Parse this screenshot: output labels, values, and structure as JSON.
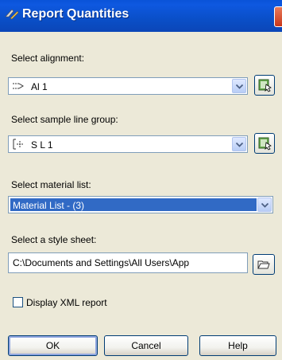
{
  "window": {
    "title": "Report Quantities"
  },
  "alignment": {
    "label": "Select alignment:",
    "value": "Al 1"
  },
  "sample_line_group": {
    "label": "Select sample line group:",
    "value": "S L 1"
  },
  "material_list": {
    "label": "Select material list:",
    "value": "Material List - (3)"
  },
  "style_sheet": {
    "label": "Select a style sheet:",
    "value": "C:\\Documents and Settings\\All Users\\App"
  },
  "xml_report": {
    "label": "Display XML report",
    "checked": false
  },
  "buttons": {
    "ok": "OK",
    "cancel": "Cancel",
    "help": "Help"
  },
  "colors": {
    "titlebar": "#0a4fc8",
    "selection": "#316ac5",
    "dialog_bg": "#ece9d8"
  }
}
